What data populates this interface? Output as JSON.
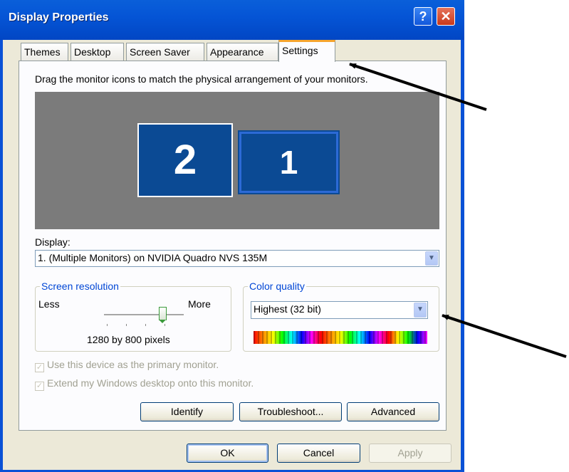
{
  "window": {
    "title": "Display Properties",
    "help_label": "?",
    "close_label": "✕"
  },
  "tabs": [
    {
      "label": "Themes"
    },
    {
      "label": "Desktop"
    },
    {
      "label": "Screen Saver"
    },
    {
      "label": "Appearance"
    },
    {
      "label": "Settings",
      "active": true
    }
  ],
  "settings": {
    "instruction": "Drag the monitor icons to match the physical arrangement of your monitors.",
    "monitors": [
      {
        "label": "2"
      },
      {
        "label": "1"
      }
    ],
    "display_label": "Display:",
    "display_value": "1. (Multiple Monitors) on NVIDIA Quadro NVS 135M",
    "resolution": {
      "title": "Screen resolution",
      "less": "Less",
      "more": "More",
      "value_text": "1280 by 800 pixels",
      "slider_position": 0.75
    },
    "color_quality": {
      "title": "Color quality",
      "value": "Highest (32 bit)"
    },
    "checkboxes": {
      "primary": "Use this device as the primary monitor.",
      "extend": "Extend my Windows desktop onto this monitor."
    },
    "buttons": {
      "identify": "Identify",
      "troubleshoot": "Troubleshoot...",
      "advanced": "Advanced"
    }
  },
  "footer": {
    "ok": "OK",
    "cancel": "Cancel",
    "apply": "Apply"
  },
  "colors": {
    "title_bar": "#0a51d6",
    "dialog_bg": "#ece9d8",
    "monitor_blue": "#0b4a94",
    "desktop_gray": "#7b7b7b",
    "group_title": "#0046d5"
  },
  "icons": [
    "help-icon",
    "close-icon",
    "dropdown-arrow-icon",
    "checkmark-icon",
    "annotation-arrow"
  ]
}
